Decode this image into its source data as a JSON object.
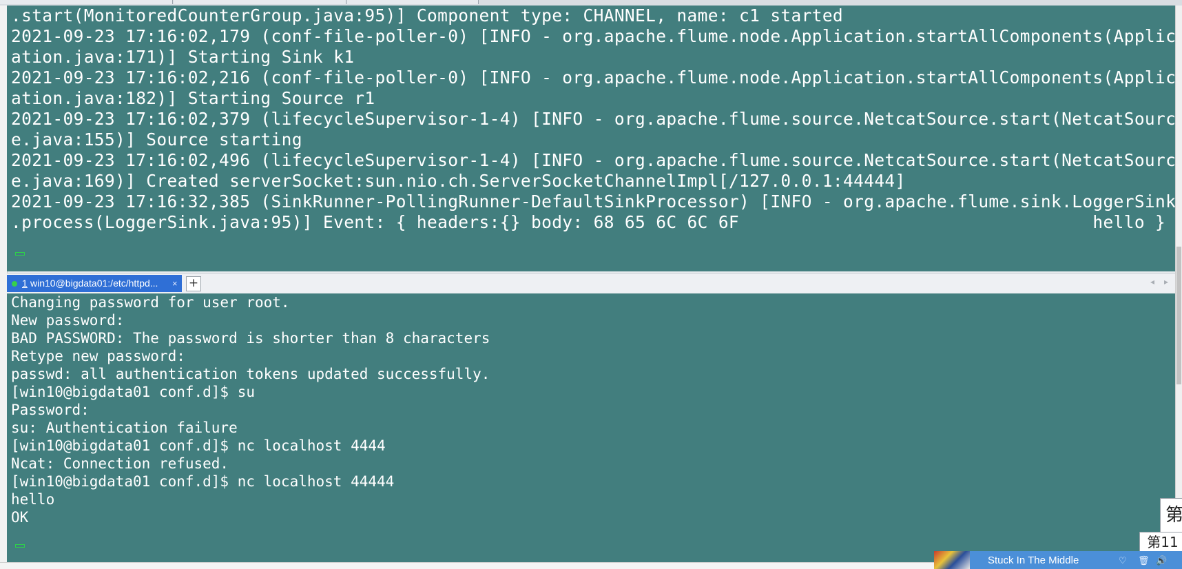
{
  "top_terminal": {
    "lines": [
      ".start(MonitoredCounterGroup.java:95)] Component type: CHANNEL, name: c1 started",
      "2021-09-23 17:16:02,179 (conf-file-poller-0) [INFO - org.apache.flume.node.Application.startAllComponents(Applic",
      "ation.java:171)] Starting Sink k1",
      "2021-09-23 17:16:02,216 (conf-file-poller-0) [INFO - org.apache.flume.node.Application.startAllComponents(Applic",
      "ation.java:182)] Starting Source r1",
      "2021-09-23 17:16:02,379 (lifecycleSupervisor-1-4) [INFO - org.apache.flume.source.NetcatSource.start(NetcatSourc",
      "e.java:155)] Source starting",
      "2021-09-23 17:16:02,496 (lifecycleSupervisor-1-4) [INFO - org.apache.flume.source.NetcatSource.start(NetcatSourc",
      "e.java:169)] Created serverSocket:sun.nio.ch.ServerSocketChannelImpl[/127.0.0.1:44444]",
      "2021-09-23 17:16:32,385 (SinkRunner-PollingRunner-DefaultSinkProcessor) [INFO - org.apache.flume.sink.LoggerSink",
      ".process(LoggerSink.java:95)] Event: { headers:{} body: 68 65 6C 6C 6F                                  hello }"
    ]
  },
  "session_tab": {
    "number": "1",
    "label": "win10@bigdata01:/etc/httpd...",
    "close_glyph": "×",
    "add_glyph": "+",
    "nav_prev": "◂",
    "nav_next": "▸"
  },
  "bottom_terminal": {
    "lines": [
      "Changing password for user root.",
      "New password:",
      "BAD PASSWORD: The password is shorter than 8 characters",
      "Retype new password:",
      "passwd: all authentication tokens updated successfully.",
      "[win10@bigdata01 conf.d]$ su",
      "Password:",
      "su: Authentication failure",
      "[win10@bigdata01 conf.d]$ nc localhost 4444",
      "Ncat: Connection refused.",
      "[win10@bigdata01 conf.d]$ nc localhost 44444",
      "hello",
      "OK"
    ]
  },
  "overlays": {
    "ime_char_1": "第",
    "ime_char_2": "第11",
    "music_title": "Stuck In The Middle",
    "music_icons": [
      "heart-icon",
      "trash-icon",
      "volume-icon"
    ]
  },
  "colors": {
    "terminal_bg": "#427e7e",
    "terminal_fg": "#ffffff",
    "tab_active": "#2f6fd6",
    "cursor": "#2ed04a"
  }
}
